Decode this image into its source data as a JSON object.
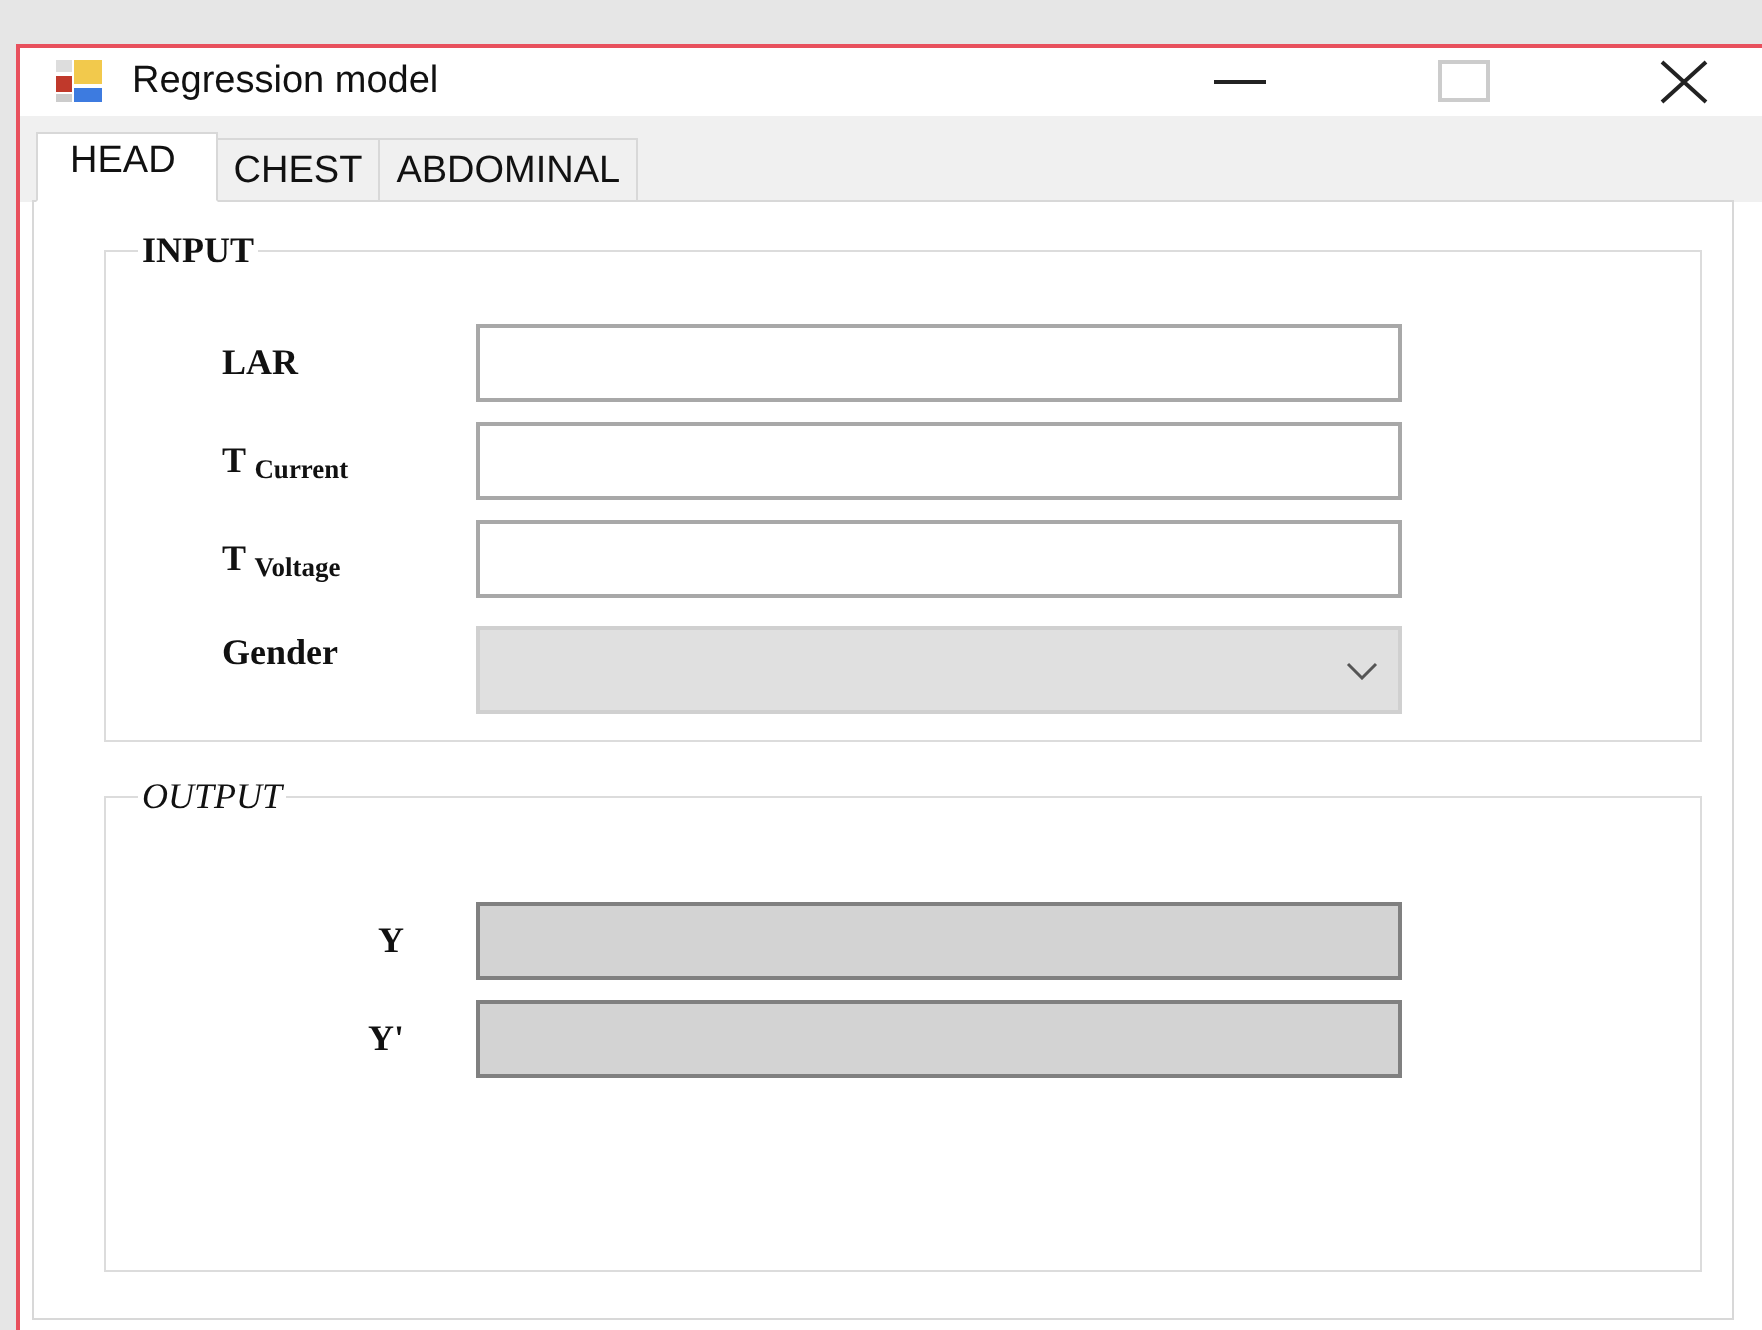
{
  "window": {
    "title": "Regression model"
  },
  "tabs": [
    {
      "label": "HEAD",
      "selected": true
    },
    {
      "label": "CHEST",
      "selected": false
    },
    {
      "label": "ABDOMINAL",
      "selected": false
    }
  ],
  "input": {
    "title": "INPUT",
    "fields": [
      {
        "label": "LAR",
        "kind": "text",
        "disabled": false
      },
      {
        "label": "T $_{Current}$",
        "kind": "text",
        "disabled": false
      },
      {
        "label": "T $_{Voltage}$",
        "kind": "text",
        "disabled": false
      },
      {
        "label": "Gender",
        "kind": "combo",
        "disabled": true
      }
    ]
  },
  "output": {
    "title": "OUTPUT",
    "fields": [
      {
        "label": "Y",
        "readonly": true
      },
      {
        "label": "Y'",
        "readonly": true
      }
    ]
  }
}
